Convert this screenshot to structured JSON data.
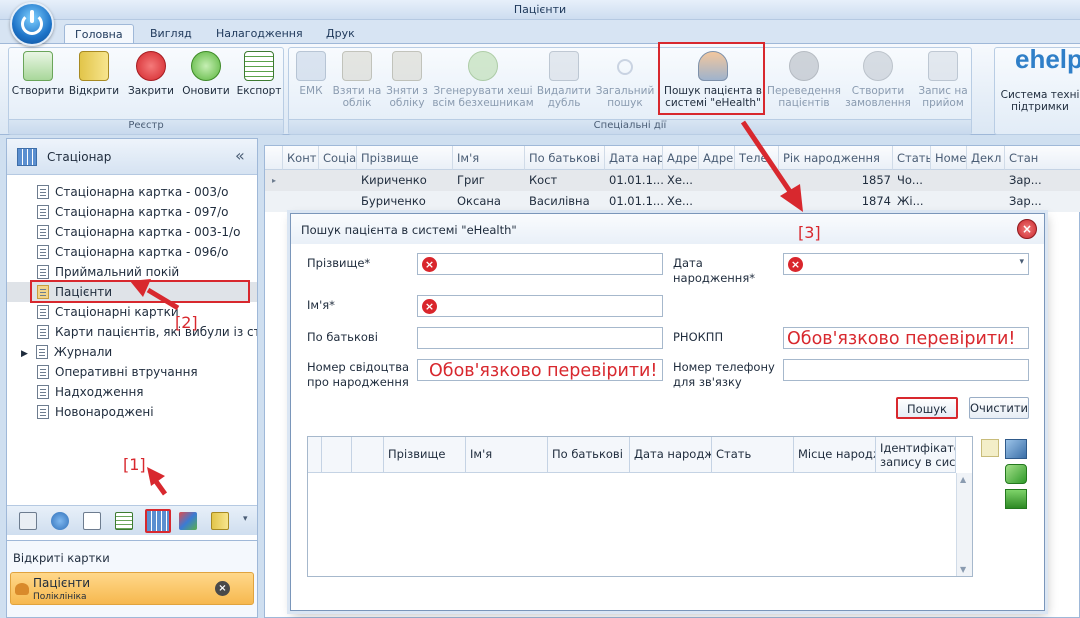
{
  "window": {
    "title": "Пацієнти"
  },
  "tabs": [
    "Головна",
    "Вигляд",
    "Налагодження",
    "Друк"
  ],
  "ribbon": {
    "registry": {
      "label": "Реєстр",
      "buttons": [
        "Створити",
        "Відкрити",
        "Закрити",
        "Оновити",
        "Експорт"
      ]
    },
    "special": {
      "label": "Спеціальні дії",
      "buttons": [
        [
          "ЕМК"
        ],
        [
          "Взяти на",
          "облік"
        ],
        [
          "Зняти з",
          "обліку"
        ],
        [
          "Згенерувати хеші",
          "всім безхешникам"
        ],
        [
          "Видалити",
          "дубль"
        ],
        [
          "Загальний",
          "пошук"
        ],
        [
          "Пошук пацієнта в",
          "системі \"eHealth\""
        ],
        [
          "Переведення",
          "пацієнтів"
        ],
        [
          "Створити",
          "замовлення"
        ],
        [
          "Запис на",
          "прийом"
        ]
      ]
    },
    "ehelp": {
      "logo": "ehelp",
      "line1": "Система техні",
      "line2": "підтримки"
    }
  },
  "sidebar": {
    "title": "Стаціонар",
    "items": [
      "Стаціонарна картка - 003/о",
      "Стаціонарна картка - 097/о",
      "Стаціонарна картка - 003-1/о",
      "Стаціонарна картка - 096/о",
      "Приймальний покій",
      "Пацієнти",
      "Стаціонарні картки",
      "Карти пацієнтів, які вибули із стаціс",
      "Журнали",
      "Оперативні втручання",
      "Надходження",
      "Новонароджені"
    ],
    "open_cards_title": "Відкриті картки",
    "open_card": {
      "title": "Пацієнти",
      "subtitle": "Поліклініка"
    }
  },
  "annotations": {
    "a1": "[1]",
    "a2": "[2]",
    "a3": "[3]"
  },
  "grid": {
    "columns": [
      "Конт",
      "Соціа",
      "Прізвище",
      "Ім'я",
      "По батькові",
      "Дата нар",
      "Адре",
      "Адре",
      "Теле",
      "Рік народження",
      "Стать",
      "Номе",
      "Декл",
      "Стан"
    ],
    "rows": [
      [
        "",
        "",
        "Кириченко",
        "Григ",
        "Кост",
        "01.01.1...",
        "Хе...",
        "",
        "",
        "1857",
        "Чо...",
        "",
        "",
        "Зар..."
      ],
      [
        "",
        "",
        "Буриченко",
        "Оксана",
        "Василівна",
        "01.01.1...",
        "Хе...",
        "",
        "",
        "1874",
        "Жі...",
        "",
        "",
        "Зар..."
      ]
    ]
  },
  "dialog": {
    "title": "Пошук пацієнта в системі \"eHealth\"",
    "labels": {
      "surname": "Прізвище*",
      "birthdate_1": "Дата",
      "birthdate_2": "народження*",
      "name": "Ім'я*",
      "patronymic": "По батькові",
      "rnokpp": "РНОКПП",
      "cert_1": "Номер свідоцтва",
      "cert_2": "про народження",
      "phone_1": "Номер телефону",
      "phone_2": "для зв'язку"
    },
    "warning": "Обов'язково перевірити!",
    "search_button": "Пошук",
    "clear_button": "Очистити",
    "results_columns": [
      "Прізвище",
      "Ім'я",
      "По батькові",
      "Дата народж",
      "Стать",
      "Місце народж"
    ],
    "results_last_col_1": "Ідентифікатор",
    "results_last_col_2": "запису в сист"
  }
}
